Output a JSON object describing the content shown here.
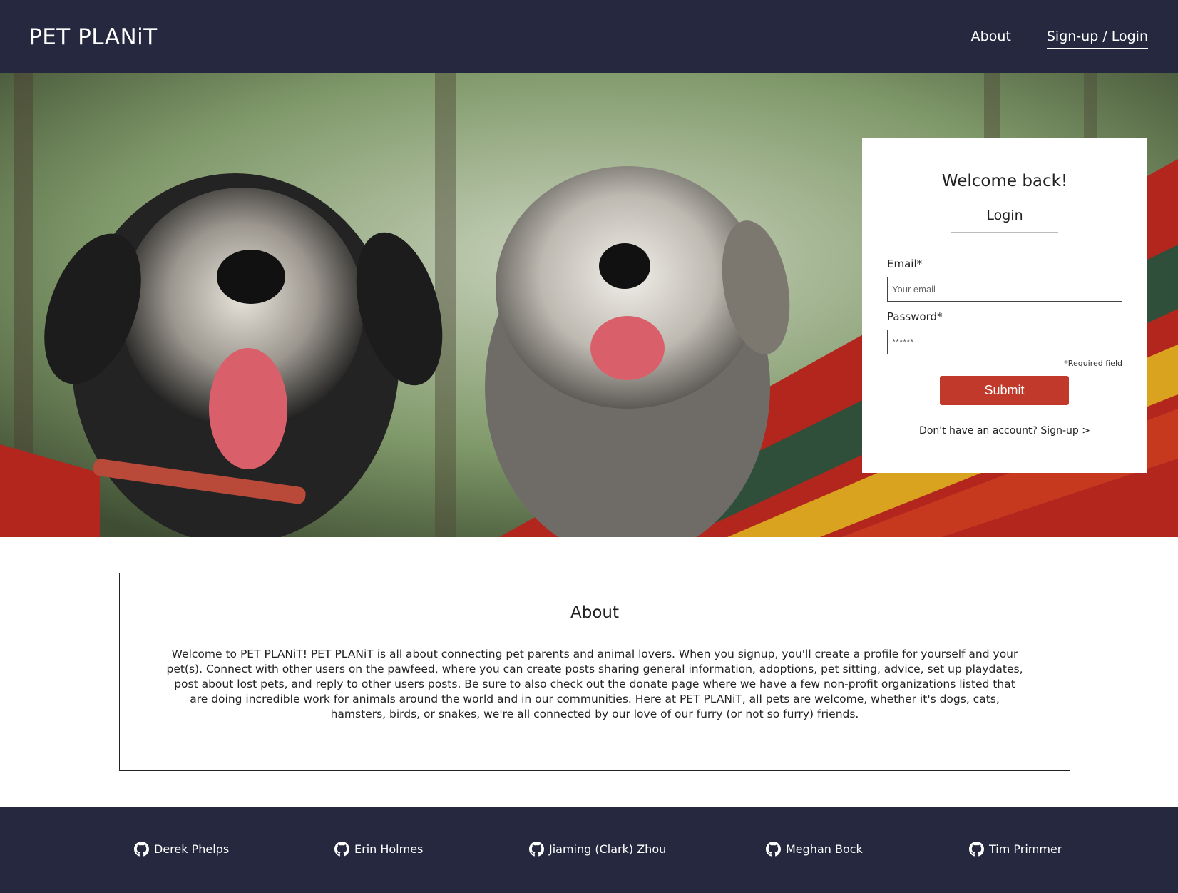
{
  "header": {
    "brand": "PET PLANiT",
    "nav": [
      {
        "label": "About"
      },
      {
        "label": "Sign-up / Login"
      }
    ]
  },
  "login": {
    "title": "Welcome back!",
    "subtitle": "Login",
    "email_label": "Email*",
    "email_placeholder": "Your email",
    "password_label": "Password*",
    "password_placeholder": "******",
    "required_note": "*Required field",
    "submit_label": "Submit",
    "signup_prompt": "Don't have an account? Sign-up >"
  },
  "about": {
    "title": "About",
    "body": "Welcome to PET PLANiT! PET PLANiT is all about connecting pet parents and animal lovers. When you signup, you'll create a profile for yourself and your pet(s). Connect with other users on the pawfeed, where you can create posts sharing general information, adoptions, pet sitting, advice, set up playdates, post about lost pets, and reply to other users posts. Be sure to also check out the donate page where we have a few non-profit organizations listed that are doing incredible work for animals around the world and in our communities. Here at PET PLANiT, all pets are welcome, whether it's dogs, cats, hamsters, birds, or snakes, we're all connected by our love of our furry (or not so furry) friends."
  },
  "footer": {
    "credits": [
      {
        "name": "Derek Phelps",
        "icon": "github-icon"
      },
      {
        "name": "Erin Holmes",
        "icon": "github-icon"
      },
      {
        "name": "Jiaming (Clark) Zhou",
        "icon": "github-icon"
      },
      {
        "name": "Meghan Bock",
        "icon": "github-icon"
      },
      {
        "name": "Tim Primmer",
        "icon": "github-icon"
      }
    ]
  },
  "colors": {
    "header_bg": "#262840",
    "submit_bg": "#c0392b"
  }
}
